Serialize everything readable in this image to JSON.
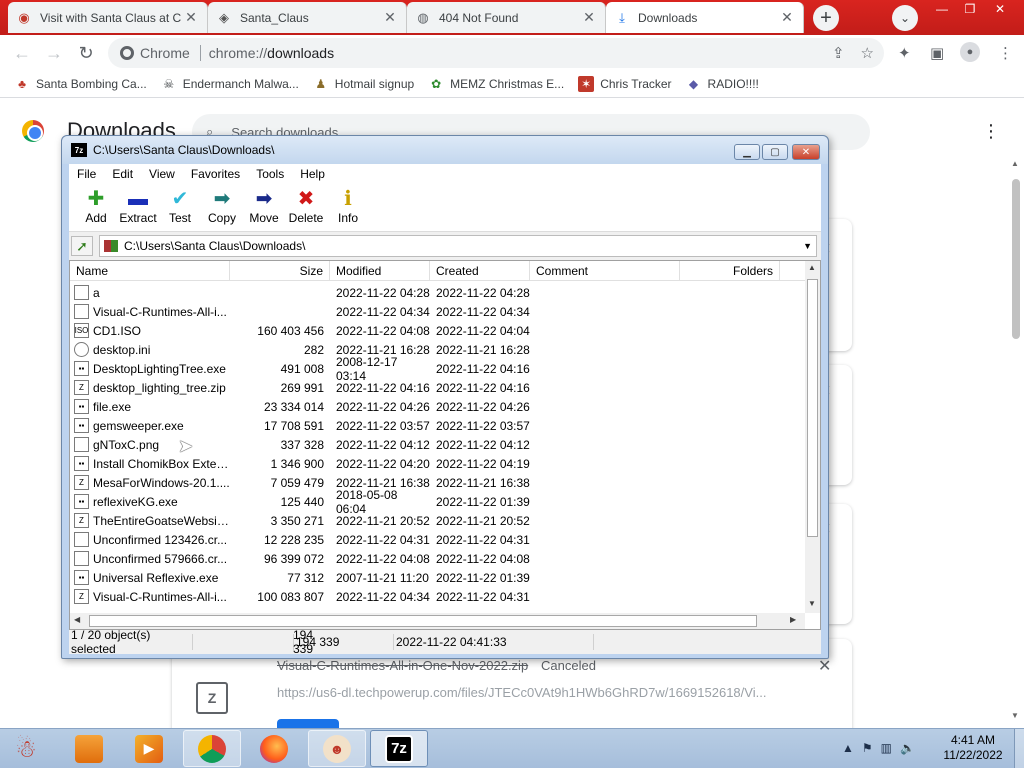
{
  "browser": {
    "tabs": [
      {
        "title": "Visit with Santa Claus at C",
        "icon": "santa-favicon"
      },
      {
        "title": "Santa_Claus",
        "icon": "wiki-favicon"
      },
      {
        "title": "404 Not Found",
        "icon": "globe-favicon"
      },
      {
        "title": "Downloads",
        "icon": "download-favicon",
        "active": true
      }
    ],
    "newtab_label": "+",
    "omnibox": {
      "site_label": "Chrome",
      "url_scheme": "chrome://",
      "url_rest": "downloads"
    },
    "bookmarks": [
      {
        "label": "Santa Bombing Ca...",
        "icon": "santa-icon"
      },
      {
        "label": "Endermanch Malwa...",
        "icon": "skull-icon"
      },
      {
        "label": "Hotmail signup",
        "icon": "person-icon"
      },
      {
        "label": "MEMZ Christmas E...",
        "icon": "memz-icon"
      },
      {
        "label": "Chris Tracker",
        "icon": "gift-icon"
      },
      {
        "label": "RADIO!!!!",
        "icon": "radio-icon"
      }
    ]
  },
  "downloads_page": {
    "title": "Downloads",
    "search_placeholder": "Search downloads",
    "item": {
      "name": "Visual-C-Runtimes-All-in-One-Nov-2022.zip",
      "status": "Canceled",
      "url": "https://us6-dl.techpowerup.com/files/JTECc0VAt9h1HWb6GhRD7w/1669152618/Vi..."
    }
  },
  "sevenzip": {
    "title": "C:\\Users\\Santa Claus\\Downloads\\",
    "menu": [
      "File",
      "Edit",
      "View",
      "Favorites",
      "Tools",
      "Help"
    ],
    "tools": [
      {
        "label": "Add",
        "glyph": "✚",
        "color": "#2e9e2a"
      },
      {
        "label": "Extract",
        "glyph": "▬",
        "color": "#1a2fb8"
      },
      {
        "label": "Test",
        "glyph": "✔",
        "color": "#30b8d8"
      },
      {
        "label": "Copy",
        "glyph": "➡",
        "color": "#1f7a7a"
      },
      {
        "label": "Move",
        "glyph": "➡",
        "color": "#1a2a8a"
      },
      {
        "label": "Delete",
        "glyph": "✖",
        "color": "#d01818"
      },
      {
        "label": "Info",
        "glyph": "ℹ",
        "color": "#c8a000"
      }
    ],
    "address": "C:\\Users\\Santa Claus\\Downloads\\",
    "columns": [
      "Name",
      "Size",
      "Modified",
      "Created",
      "Comment",
      "Folders"
    ],
    "files": [
      {
        "name": "a",
        "size": "",
        "modified": "2022-11-22 04:28",
        "created": "2022-11-22 04:28",
        "type": "folder"
      },
      {
        "name": "Visual-C-Runtimes-All-i...",
        "size": "",
        "modified": "2022-11-22 04:34",
        "created": "2022-11-22 04:34",
        "type": "folder"
      },
      {
        "name": "CD1.ISO",
        "size": "160 403 456",
        "modified": "2022-11-22 04:08",
        "created": "2022-11-22 04:04",
        "type": "iso"
      },
      {
        "name": "desktop.ini",
        "size": "282",
        "modified": "2022-11-21 16:28",
        "created": "2022-11-21 16:28",
        "type": "ini"
      },
      {
        "name": "DesktopLightingTree.exe",
        "size": "491 008",
        "modified": "2008-12-17 03:14",
        "created": "2022-11-22 04:16",
        "type": "exe"
      },
      {
        "name": "desktop_lighting_tree.zip",
        "size": "269 991",
        "modified": "2022-11-22 04:16",
        "created": "2022-11-22 04:16",
        "type": "zip"
      },
      {
        "name": "file.exe",
        "size": "23 334 014",
        "modified": "2022-11-22 04:26",
        "created": "2022-11-22 04:26",
        "type": "exe"
      },
      {
        "name": "gemsweeper.exe",
        "size": "17 708 591",
        "modified": "2022-11-22 03:57",
        "created": "2022-11-22 03:57",
        "type": "exe"
      },
      {
        "name": "gNToxC.png",
        "size": "337 328",
        "modified": "2022-11-22 04:12",
        "created": "2022-11-22 04:12",
        "type": "png"
      },
      {
        "name": "Install ChomikBox Exten...",
        "size": "1 346 900",
        "modified": "2022-11-22 04:20",
        "created": "2022-11-22 04:19",
        "type": "exe"
      },
      {
        "name": "MesaForWindows-20.1....",
        "size": "7 059 479",
        "modified": "2022-11-21 16:38",
        "created": "2022-11-21 16:38",
        "type": "zip"
      },
      {
        "name": "reflexiveKG.exe",
        "size": "125 440",
        "modified": "2018-05-08 06:04",
        "created": "2022-11-22 01:39",
        "type": "exe"
      },
      {
        "name": "TheEntireGoatseWebsit...",
        "size": "3 350 271",
        "modified": "2022-11-21 20:52",
        "created": "2022-11-21 20:52",
        "type": "zip"
      },
      {
        "name": "Unconfirmed 123426.cr...",
        "size": "12 228 235",
        "modified": "2022-11-22 04:31",
        "created": "2022-11-22 04:31",
        "type": "blank"
      },
      {
        "name": "Unconfirmed 579666.cr...",
        "size": "96 399 072",
        "modified": "2022-11-22 04:08",
        "created": "2022-11-22 04:08",
        "type": "blank"
      },
      {
        "name": "Universal Reflexive.exe",
        "size": "77 312",
        "modified": "2007-11-21 11:20",
        "created": "2022-11-22 01:39",
        "type": "exe"
      },
      {
        "name": "Visual-C-Runtimes-All-i...",
        "size": "100 083 807",
        "modified": "2022-11-22 04:34",
        "created": "2022-11-22 04:31",
        "type": "zip"
      }
    ],
    "status": {
      "selection": "1 / 20 object(s) selected",
      "size": "194 339",
      "packed": "194 339",
      "date": "2022-11-22 04:41:33"
    }
  },
  "taskbar": {
    "apps": [
      {
        "name": "explorer",
        "icon": "folder-icon"
      },
      {
        "name": "media",
        "icon": "media-player-icon"
      },
      {
        "name": "chrome",
        "icon": "chrome-icon"
      },
      {
        "name": "firefox",
        "icon": "firefox-icon"
      },
      {
        "name": "santa",
        "icon": "santa-app-icon"
      },
      {
        "name": "7zip",
        "icon": "7zip-icon",
        "label": "7z"
      }
    ],
    "clock": {
      "time": "4:41 AM",
      "date": "11/22/2022"
    }
  }
}
